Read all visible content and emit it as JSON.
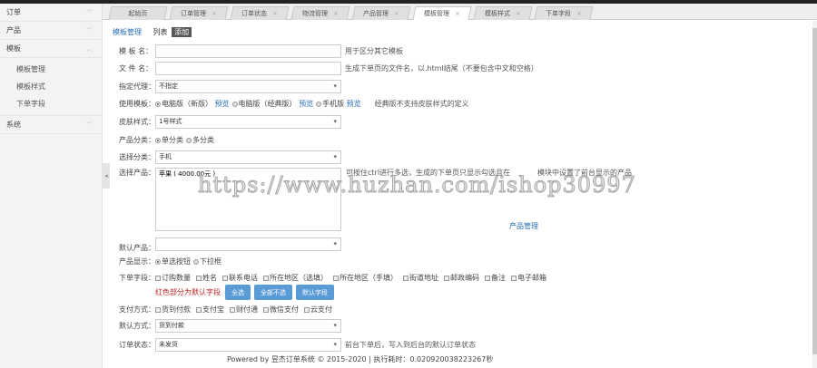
{
  "sidebar": {
    "items": [
      {
        "label": "订单"
      },
      {
        "label": "产品"
      },
      {
        "label": "模板"
      }
    ],
    "sub": [
      "模板管理",
      "模板样式",
      "下单字段"
    ],
    "system": "系统"
  },
  "tabs": [
    {
      "label": "起始页"
    },
    {
      "label": "订单管理"
    },
    {
      "label": "订单状态"
    },
    {
      "label": "物流管理"
    },
    {
      "label": "产品管理"
    },
    {
      "label": "模板管理"
    },
    {
      "label": "模板样式"
    },
    {
      "label": "下单字段"
    }
  ],
  "active_tab": "模板管理",
  "breadcrumb": {
    "title": "模板管理",
    "list": "列表",
    "add": "添加"
  },
  "form": {
    "name": {
      "label": "模 板 名：",
      "value": "",
      "hint": "用于区分其它模板"
    },
    "file": {
      "label": "文 件 名：",
      "value": "",
      "hint": "生成下单页的文件名，以.html结尾（不要包含中文和空格）"
    },
    "agent": {
      "label": "指定代理：",
      "value": "不指定"
    },
    "template": {
      "label": "使用模板：",
      "options": [
        "电脑版（新版）",
        "电脑版（经典版）",
        "手机版"
      ],
      "preview": "预览",
      "selected": 0,
      "hint": "经典版不支持皮肤样式的定义"
    },
    "skin": {
      "label": "皮肤样式：",
      "value": "1号样式"
    },
    "category_type": {
      "label": "产品分类：",
      "options": [
        "单分类",
        "多分类"
      ],
      "selected": 0
    },
    "category": {
      "label": "选择分类：",
      "value": "手机"
    },
    "products": {
      "label": "选择产品：",
      "value": "苹果 ( 4000.00元 )",
      "hint": "可按住ctrl进行多选，生成的下单页只显示勾选且在",
      "hint2": "模块中设置了前台显示的产品",
      "link": "产品管理"
    },
    "default_product": {
      "label": "默认产品：",
      "value": ""
    },
    "display": {
      "label": "产品显示：",
      "options": [
        "单选按钮",
        "下拉框"
      ],
      "selected": 0
    },
    "fields": {
      "label": "下单字段：",
      "options": [
        "订购数量",
        "姓名",
        "联系电话",
        "所在地区（选填）",
        "所在地区（手填）",
        "街道地址",
        "邮政编码",
        "备注",
        "电子邮箱"
      ],
      "note": "红色部分为默认字段",
      "buttons": [
        "全选",
        "全部不选",
        "默认字段"
      ]
    },
    "payment": {
      "label": "支付方式：",
      "options": [
        "货到付款",
        "支付宝",
        "财付通",
        "微信支付",
        "云支付"
      ]
    },
    "default_payment": {
      "label": "默认方式：",
      "value": "货到付款"
    },
    "status": {
      "label": "订单状态：",
      "value": "未发货",
      "hint": "前台下单后，写入到后台的默认订单状态"
    }
  },
  "watermark": "https://www.huzhan.com/ishop30997",
  "footer": "Powered by 昱杰订单系统 © 2015-2020  |  执行耗时：0.020920038223267秒"
}
